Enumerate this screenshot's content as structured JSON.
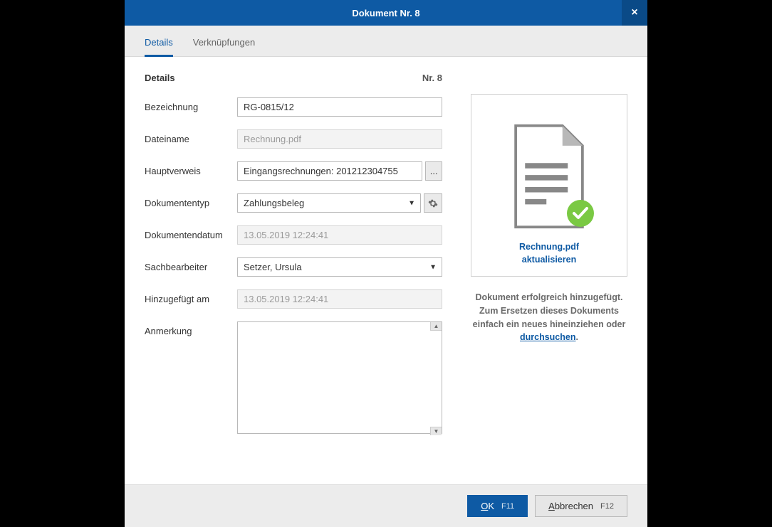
{
  "title": "Dokument Nr. 8",
  "tabs": {
    "details": "Details",
    "links": "Verknüpfungen"
  },
  "section": {
    "heading": "Details",
    "number": "Nr. 8"
  },
  "fields": {
    "bezeichnung": {
      "label": "Bezeichnung",
      "value": "RG-0815/12"
    },
    "dateiname": {
      "label": "Dateiname",
      "value": "Rechnung.pdf"
    },
    "hauptverweis": {
      "label": "Hauptverweis",
      "value": "Eingangsrechnungen: 201212304755",
      "browse": "..."
    },
    "dokumententyp": {
      "label": "Dokumententyp",
      "value": "Zahlungsbeleg"
    },
    "dokumentendatum": {
      "label": "Dokumentendatum",
      "value": "13.05.2019 12:24:41"
    },
    "sachbearbeiter": {
      "label": "Sachbearbeiter",
      "value": "Setzer, Ursula"
    },
    "hinzugefuegt": {
      "label": "Hinzugefügt am",
      "value": "13.05.2019 12:24:41"
    },
    "anmerkung": {
      "label": "Anmerkung",
      "value": ""
    }
  },
  "preview": {
    "filename": "Rechnung.pdf",
    "update": "aktualisieren",
    "hint1": "Dokument erfolgreich hinzugefügt.",
    "hint2": "Zum Ersetzen dieses Dokuments",
    "hint3": "einfach ein neues hineinziehen oder",
    "browse": "durchsuchen"
  },
  "buttons": {
    "ok": {
      "label": "OK",
      "key": "F11",
      "accel": "O"
    },
    "cancel": {
      "label": "Abbrechen",
      "key": "F12",
      "accel": "A"
    }
  }
}
